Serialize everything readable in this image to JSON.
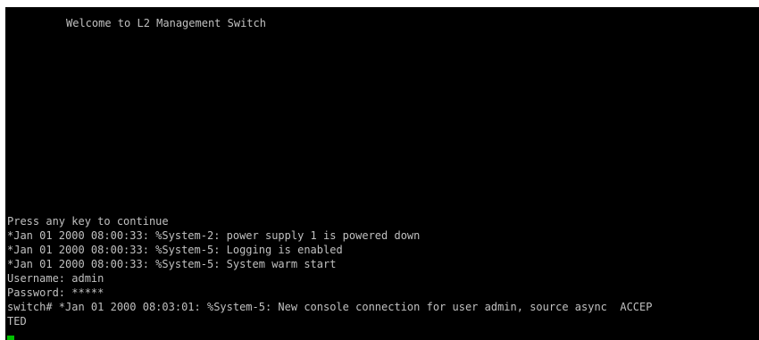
{
  "terminal": {
    "welcome": "Welcome to L2 Management Switch",
    "lines": [
      "Press any key to continue",
      "*Jan 01 2000 08:00:33: %System-2: power supply 1 is powered down",
      "*Jan 01 2000 08:00:33: %System-5: Logging is enabled",
      "*Jan 01 2000 08:00:33: %System-5: System warm start",
      "Username: admin",
      "Password: *****",
      "switch# *Jan 01 2000 08:03:01: %System-5: New console connection for user admin, source async  ACCEP",
      "TED"
    ],
    "cursor_color": "#00c000",
    "text_color": "#c0c0c0",
    "background_color": "#000000"
  }
}
